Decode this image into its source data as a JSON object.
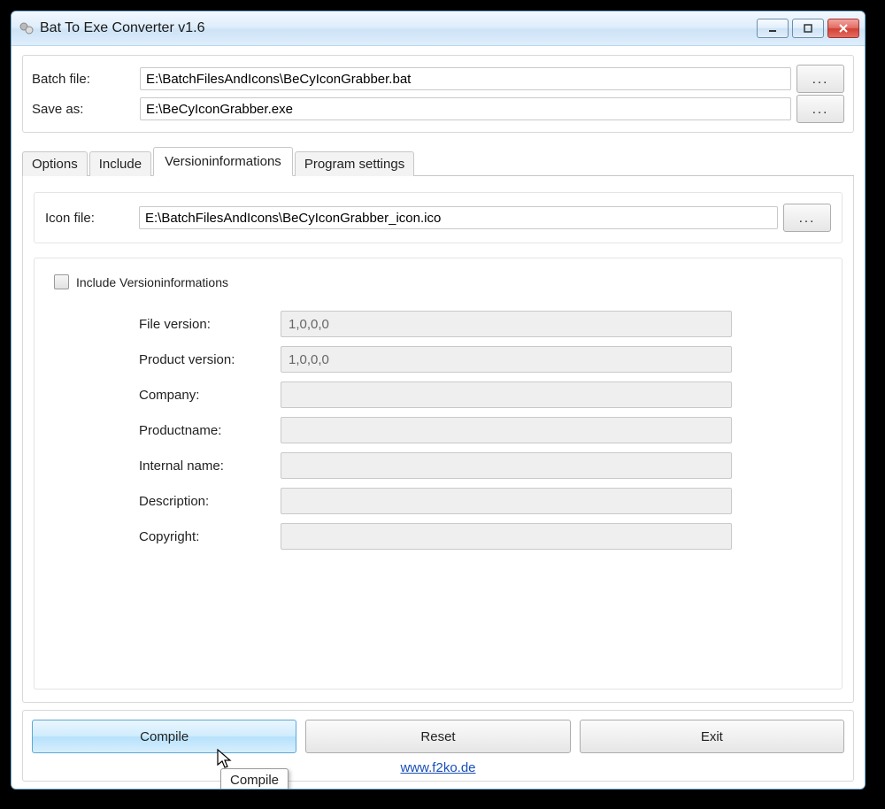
{
  "window": {
    "title": "Bat To Exe Converter v1.6"
  },
  "header": {
    "batch_label": "Batch file:",
    "batch_value": "E:\\BatchFilesAndIcons\\BeCyIconGrabber.bat",
    "save_label": "Save as:",
    "save_value": "E:\\BeCyIconGrabber.exe",
    "browse_label": "..."
  },
  "tabs": {
    "options": "Options",
    "include": "Include",
    "versioninfo": "Versioninformations",
    "program_settings": "Program settings"
  },
  "icon_row": {
    "label": "Icon file:",
    "value": "E:\\BatchFilesAndIcons\\BeCyIconGrabber_icon.ico",
    "browse_label": "..."
  },
  "include_checkbox_label": "Include Versioninformations",
  "fields": {
    "file_version": {
      "label": "File version:",
      "value": "1,0,0,0"
    },
    "product_version": {
      "label": "Product version:",
      "value": "1,0,0,0"
    },
    "company": {
      "label": "Company:",
      "value": ""
    },
    "productname": {
      "label": "Productname:",
      "value": ""
    },
    "internal_name": {
      "label": "Internal name:",
      "value": ""
    },
    "description": {
      "label": "Description:",
      "value": ""
    },
    "copyright": {
      "label": "Copyright:",
      "value": ""
    }
  },
  "bottom": {
    "compile": "Compile",
    "reset": "Reset",
    "exit": "Exit",
    "link": "www.f2ko.de"
  },
  "tooltip": "Compile"
}
